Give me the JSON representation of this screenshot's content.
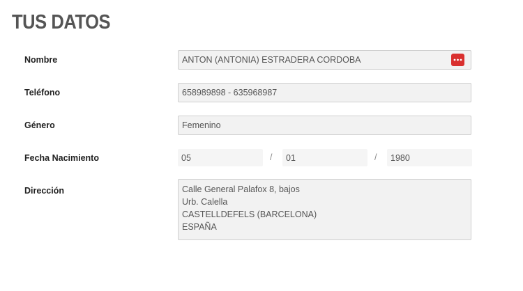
{
  "page": {
    "title": "TUS DATOS"
  },
  "fields": {
    "nombre": {
      "label": "Nombre",
      "value": "ANTON (ANTONIA) ESTRADERA CORDOBA"
    },
    "telefono": {
      "label": "Teléfono",
      "value": "658989898 - 635968987"
    },
    "genero": {
      "label": "Género",
      "value": "Femenino"
    },
    "fecha": {
      "label": "Fecha Nacimiento",
      "day": "05",
      "month": "01",
      "year": "1980",
      "separator": "/"
    },
    "direccion": {
      "label": "Dirección",
      "lines": [
        "Calle General Palafox 8, bajos",
        "Urb. Calella",
        "CASTELLDEFELS (BARCELONA)",
        "ESPAÑA"
      ]
    }
  },
  "icons": {
    "password_manager": "password-manager-icon",
    "password_manager_color": "#d9302f"
  }
}
